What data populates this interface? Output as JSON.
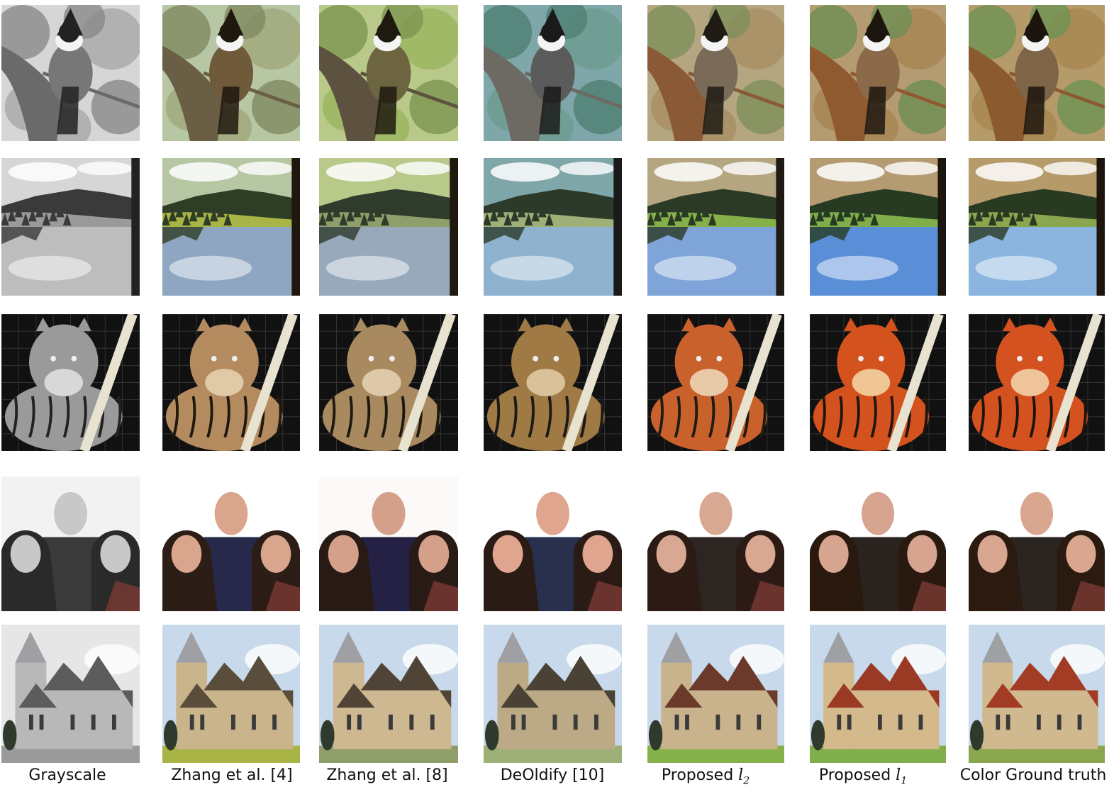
{
  "columns": [
    {
      "label": "Grayscale"
    },
    {
      "label": "Zhang et al. [4]"
    },
    {
      "label": "Zhang et al. [8]"
    },
    {
      "label": "DeOldify [10]"
    },
    {
      "label": "Proposed ",
      "math": "l",
      "sub": "2"
    },
    {
      "label": "Proposed ",
      "math": "l",
      "sub": "1"
    },
    {
      "label": "Color Ground truth"
    }
  ],
  "rows": [
    "bird",
    "lake",
    "tiger",
    "family",
    "church"
  ],
  "palettes": [
    {
      "name": "grayscale",
      "sky": "#d6d6d6",
      "leaf": "#a8a8a8",
      "leaf2": "#8a8a8a",
      "branch": "#6a6a6a",
      "bird": "#777777",
      "dark": "#222222",
      "water": "#bdbdbd",
      "grass": "#9a9a9a",
      "tree": "#3a3a3a",
      "tigerA": "#9a9a9a",
      "tigerB": "#d8d8d8",
      "wall": "#b8b8b8",
      "roof": "#5c5c5c",
      "skin": "#c8c8c8",
      "shirt": "#3a3a3a",
      "hair": "#2a2a2a",
      "bg": "#f2f2f2"
    },
    {
      "name": "zhang4",
      "sky": "#b7c7a4",
      "leaf": "#a0a67a",
      "leaf2": "#7f8860",
      "branch": "#6a5f45",
      "bird": "#6f5a3a",
      "dark": "#20180f",
      "water": "#8fa6c2",
      "grass": "#a9b447",
      "tree": "#2e3d26",
      "tigerA": "#b38b5f",
      "tigerB": "#e0c9a6",
      "wall": "#c9b48c",
      "roof": "#5a4d3c",
      "skin": "#d9a58c",
      "shirt": "#27294a",
      "hair": "#2c1d16",
      "bg": "#ffffff"
    },
    {
      "name": "zhang8",
      "sky": "#b8c98a",
      "leaf": "#98b55e",
      "leaf2": "#7c9650",
      "branch": "#5d5140",
      "bird": "#6d6440",
      "dark": "#1f1a10",
      "water": "#98a9bc",
      "grass": "#8f9e6a",
      "tree": "#2f3b2b",
      "tigerA": "#a98a60",
      "tigerB": "#ddc9a8",
      "wall": "#cdb891",
      "roof": "#4f4435",
      "skin": "#d4a08a",
      "shirt": "#252145",
      "hair": "#281b15",
      "bg": "#fbfaf8"
    },
    {
      "name": "deoldify",
      "sky": "#7fa6a8",
      "leaf": "#6e9c8f",
      "leaf2": "#4f7f72",
      "branch": "#6c6a63",
      "bird": "#5b5b5b",
      "dark": "#1a1a1a",
      "water": "#8fb3cf",
      "grass": "#9faf78",
      "tree": "#2c3a2a",
      "tigerA": "#a07a45",
      "tigerB": "#d9c29a",
      "wall": "#bca985",
      "roof": "#4b4236",
      "skin": "#e0a58f",
      "shirt": "#28304d",
      "hair": "#2a1b14",
      "bg": "#ffffff"
    },
    {
      "name": "proposed-l2",
      "sky": "#b4a680",
      "leaf": "#a78e61",
      "leaf2": "#7f8f5a",
      "branch": "#8a5a36",
      "bird": "#7a6a58",
      "dark": "#1f1a14",
      "water": "#7ea4d8",
      "grass": "#86b14a",
      "tree": "#2a3a24",
      "tigerA": "#c9612c",
      "tigerB": "#e8c9a8",
      "wall": "#c8b38c",
      "roof": "#6c3a2a",
      "skin": "#d8a892",
      "shirt": "#2d2522",
      "hair": "#2c1b14",
      "bg": "#ffffff"
    },
    {
      "name": "proposed-l1",
      "sky": "#b59b72",
      "leaf": "#a78552",
      "leaf2": "#6e8f52",
      "branch": "#8f5a30",
      "bird": "#8a6a48",
      "dark": "#1d160f",
      "water": "#5a8fd8",
      "grass": "#7fae4a",
      "tree": "#273a22",
      "tigerA": "#d4521d",
      "tigerB": "#f0c694",
      "wall": "#d3b98c",
      "roof": "#9a3a24",
      "skin": "#d7a58f",
      "shirt": "#2a2320",
      "hair": "#29190f",
      "bg": "#ffffff"
    },
    {
      "name": "ground-truth",
      "sky": "#b59a6a",
      "leaf": "#a88650",
      "leaf2": "#6f9254",
      "branch": "#8c5a2f",
      "bird": "#7e6548",
      "dark": "#1c140d",
      "water": "#8bb5de",
      "grass": "#8aa64e",
      "tree": "#293a23",
      "tigerA": "#d3521f",
      "tigerB": "#efc49a",
      "wall": "#d0b98e",
      "roof": "#a33c24",
      "skin": "#d9a68f",
      "shirt": "#2b2522",
      "hair": "#2a1a10",
      "bg": "#ffffff"
    }
  ]
}
